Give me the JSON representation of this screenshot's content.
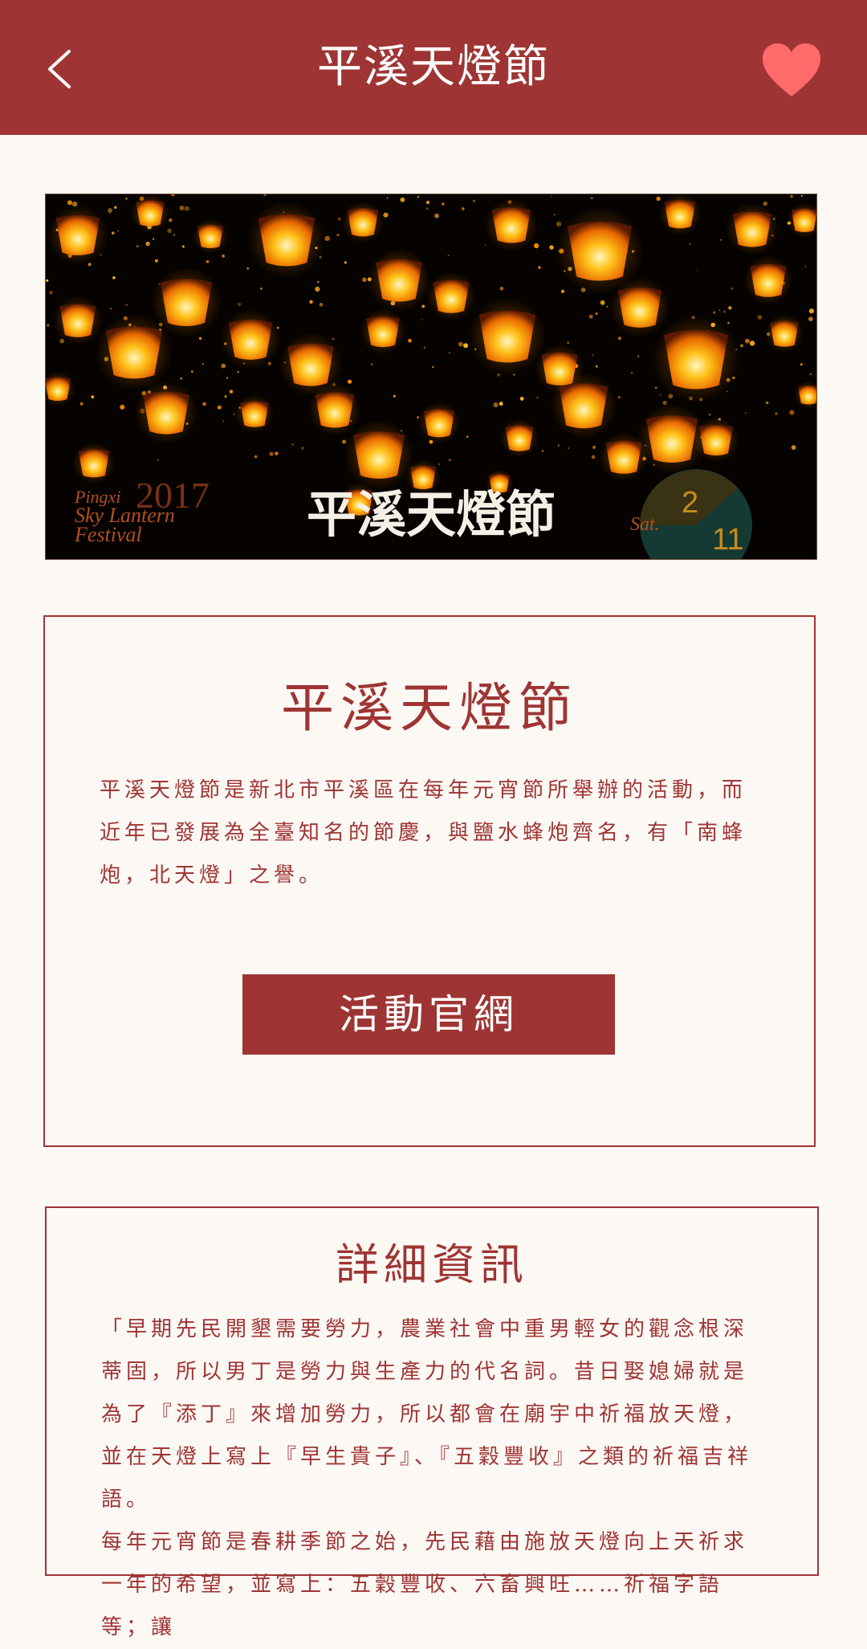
{
  "header": {
    "title": "平溪天燈節",
    "back_icon": "chevron-left-icon",
    "favorite_icon": "heart-icon",
    "favorite_color": "#ff6b6b",
    "bar_color": "#9e3534"
  },
  "banner": {
    "festival_name_en_line1": "Pingxi",
    "festival_name_en_line2": "Sky Lantern",
    "festival_name_en_line3": "Festival",
    "year": "2017",
    "calligraphy_title": "平溪天燈節",
    "weekday": "Sat.",
    "month": "2",
    "day": "11"
  },
  "intro": {
    "title": "平溪天燈節",
    "body": "平溪天燈節是新北市平溪區在每年元宵節所舉辦的活動，而近年已發展為全臺知名的節慶，與鹽水蜂炮齊名，有「南蜂炮，北天燈」之譽。",
    "official_site_button": "活動官網"
  },
  "details": {
    "title": "詳細資訊",
    "paragraph1": "「早期先民開墾需要勞力，農業社會中重男輕女的觀念根深蒂固，所以男丁是勞力與生產力的代名詞。昔日娶媳婦就是為了『添丁』來增加勞力，所以都會在廟宇中祈福放天燈，並在天燈上寫上『早生貴子』、『五穀豐收』之類的祈福吉祥語。",
    "paragraph2": "每年元宵節是春耕季節之始，先民藉由施放天燈向上天祈求一年的希望，並寫上：五穀豐收、六畜興旺……祈福字語等；讓"
  }
}
